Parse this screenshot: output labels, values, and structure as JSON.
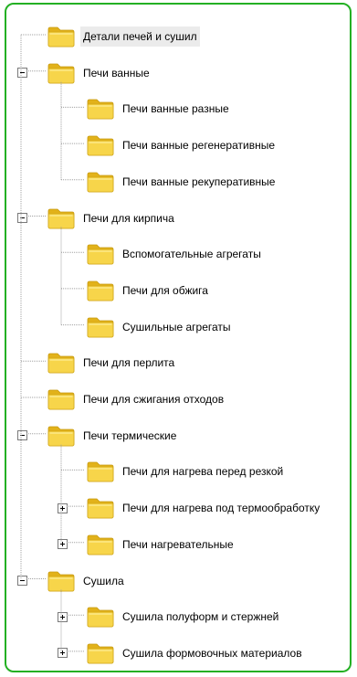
{
  "tree": {
    "items": [
      {
        "label": "Детали печей и сушил",
        "level": 0,
        "selected": true
      },
      {
        "label": "Печи ванные",
        "level": 0,
        "toggle": "minus"
      },
      {
        "label": "Печи ванные разные",
        "level": 1
      },
      {
        "label": "Печи ванные регенеративные",
        "level": 1
      },
      {
        "label": "Печи ванные рекуперативные",
        "level": 1
      },
      {
        "label": "Печи для кирпича",
        "level": 0,
        "toggle": "minus"
      },
      {
        "label": "Вспомогательные агрегаты",
        "level": 1
      },
      {
        "label": "Печи для обжига",
        "level": 1
      },
      {
        "label": "Сушильные агрегаты",
        "level": 1
      },
      {
        "label": "Печи для перлита",
        "level": 0
      },
      {
        "label": "Печи для сжигания отходов",
        "level": 0
      },
      {
        "label": "Печи термические",
        "level": 0,
        "toggle": "minus"
      },
      {
        "label": "Печи для нагрева перед резкой",
        "level": 1
      },
      {
        "label": "Печи для нагрева под термообработку",
        "level": 1,
        "toggle": "plus"
      },
      {
        "label": "Печи нагревательные",
        "level": 1,
        "toggle": "plus"
      },
      {
        "label": "Сушила",
        "level": 0,
        "toggle": "minus"
      },
      {
        "label": "Сушила полуформ и стержней",
        "level": 1,
        "toggle": "plus"
      },
      {
        "label": "Сушила формовочных материалов",
        "level": 1,
        "toggle": "plus"
      }
    ]
  },
  "colors": {
    "border": "#23b023",
    "folder_fill": "#f7d54a",
    "folder_dark": "#e2b21a",
    "connector": "#a0a0a0",
    "selection": "#ebebeb"
  },
  "icons": {
    "node": "folder-icon",
    "expanded": "minus-box-icon",
    "collapsed": "plus-box-icon"
  }
}
